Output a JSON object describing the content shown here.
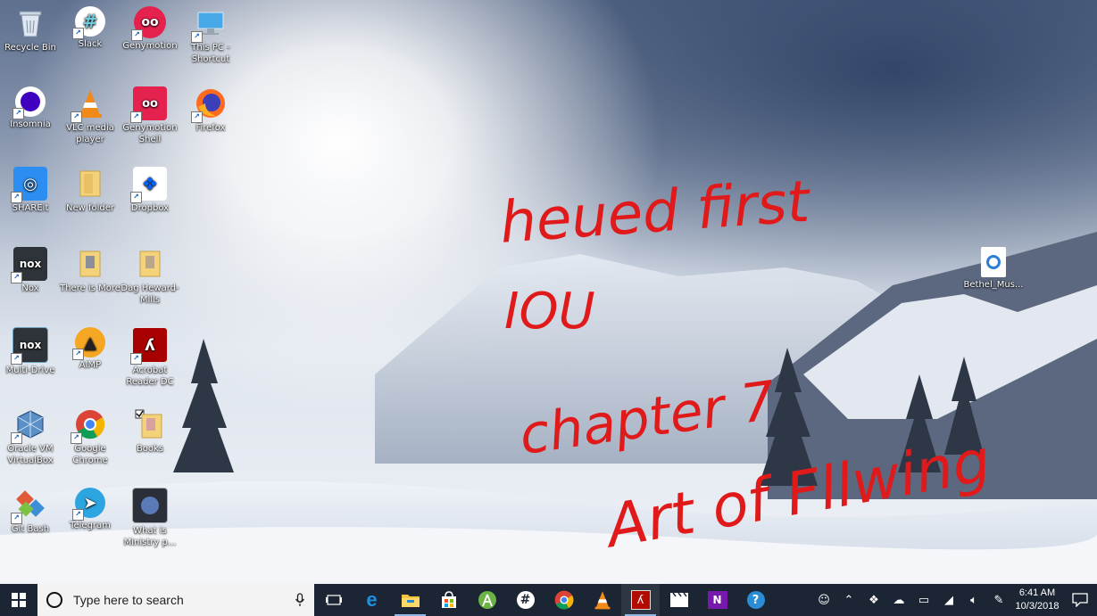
{
  "desktop": {
    "icons": [
      {
        "label": "Recycle Bin",
        "icon": "recycle-bin-icon"
      },
      {
        "label": "Slack",
        "icon": "slack-icon"
      },
      {
        "label": "Genymotion",
        "icon": "genymotion-icon"
      },
      {
        "label": "This PC - Shortcut",
        "icon": "this-pc-icon"
      },
      {
        "label": "Insomnia",
        "icon": "insomnia-icon"
      },
      {
        "label": "VLC media player",
        "icon": "vlc-icon"
      },
      {
        "label": "Genymotion Shell",
        "icon": "genymotion-shell-icon"
      },
      {
        "label": "Firefox",
        "icon": "firefox-icon"
      },
      {
        "label": "SHAREit",
        "icon": "shareit-icon"
      },
      {
        "label": "New folder",
        "icon": "folder-icon"
      },
      {
        "label": "Dropbox",
        "icon": "dropbox-icon"
      },
      {
        "label": "Nox",
        "icon": "nox-icon"
      },
      {
        "label": "There is More",
        "icon": "folder-icon"
      },
      {
        "label": "Dag Heward-Mills",
        "icon": "folder-icon"
      },
      {
        "label": "Multi-Drive",
        "icon": "multi-drive-icon"
      },
      {
        "label": "AIMP",
        "icon": "aimp-icon"
      },
      {
        "label": "Acrobat Reader DC",
        "icon": "acrobat-icon"
      },
      {
        "label": "Oracle VM VirtualBox",
        "icon": "virtualbox-icon"
      },
      {
        "label": "Google Chrome",
        "icon": "chrome-icon"
      },
      {
        "label": "Books",
        "icon": "folder-icon"
      },
      {
        "label": "Git Bash",
        "icon": "git-bash-icon"
      },
      {
        "label": "Telegram",
        "icon": "telegram-icon"
      },
      {
        "label": "What is Ministry p...",
        "icon": "video-file-icon"
      },
      {
        "label": "Bethel_Mus...",
        "icon": "audio-file-icon"
      }
    ],
    "handwriting": [
      "heued first",
      "IOU",
      "chapter 7",
      "Art of Fllwing"
    ]
  },
  "taskbar": {
    "search_placeholder": "Type here to search",
    "pinned": [
      "task-view-icon",
      "edge-icon",
      "file-explorer-icon",
      "store-icon",
      "android-studio-icon",
      "slack-icon",
      "chrome-icon",
      "vlc-icon",
      "acrobat-icon",
      "movies-icon",
      "onenote-icon",
      "help-icon"
    ],
    "tray": [
      "people-icon",
      "chevron-up-icon",
      "dropbox-icon",
      "onedrive-icon",
      "battery-icon",
      "wifi-icon",
      "volume-icon",
      "pen-icon"
    ],
    "time": "6:41 AM",
    "date": "10/3/2018"
  }
}
